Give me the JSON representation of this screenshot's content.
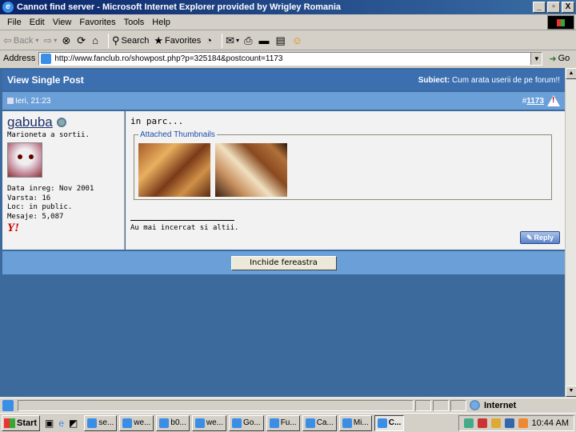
{
  "window": {
    "title": "Cannot find server - Microsoft Internet Explorer provided by Wrigley Romania",
    "buttons": [
      "_",
      "Ѧ",
      "X"
    ]
  },
  "menu": [
    "File",
    "Edit",
    "View",
    "Favorites",
    "Tools",
    "Help"
  ],
  "toolbar": {
    "back": "Back",
    "search": "Search",
    "favorites": "Favorites"
  },
  "address": {
    "label": "Address",
    "url": "http://www.fanclub.ro/showpost.php?p=325184&postcount=1173",
    "go": "Go"
  },
  "page": {
    "header_title": "View Single Post",
    "subject_label": "Subiect:",
    "subject_value": "Cum arata userii de pe forum!!",
    "post_date": "Ieri, 21:23",
    "post_number_prefix": "#",
    "post_number": "1173",
    "user": {
      "name": "gabuba",
      "title": "Marioneta a sortii.",
      "info": [
        "Data inreg: Nov 2001",
        "Varsta: 16",
        "Loc: in public.",
        "Mesaje: 5,087"
      ],
      "yahoo": "Y!"
    },
    "post_text": "in parc...",
    "attachments_legend": "Attached Thumbnails",
    "signature": "Au mai incercat si altii.",
    "reply_label": "Reply",
    "close_button": "Inchide fereastra"
  },
  "status": {
    "zone": "Internet"
  },
  "taskbar": {
    "start": "Start",
    "tasks": [
      "se...",
      "we...",
      "b0...",
      "we...",
      "Go...",
      "Fu...",
      "Ca...",
      "Mi...",
      "C..."
    ],
    "clock": "10:44 AM"
  }
}
